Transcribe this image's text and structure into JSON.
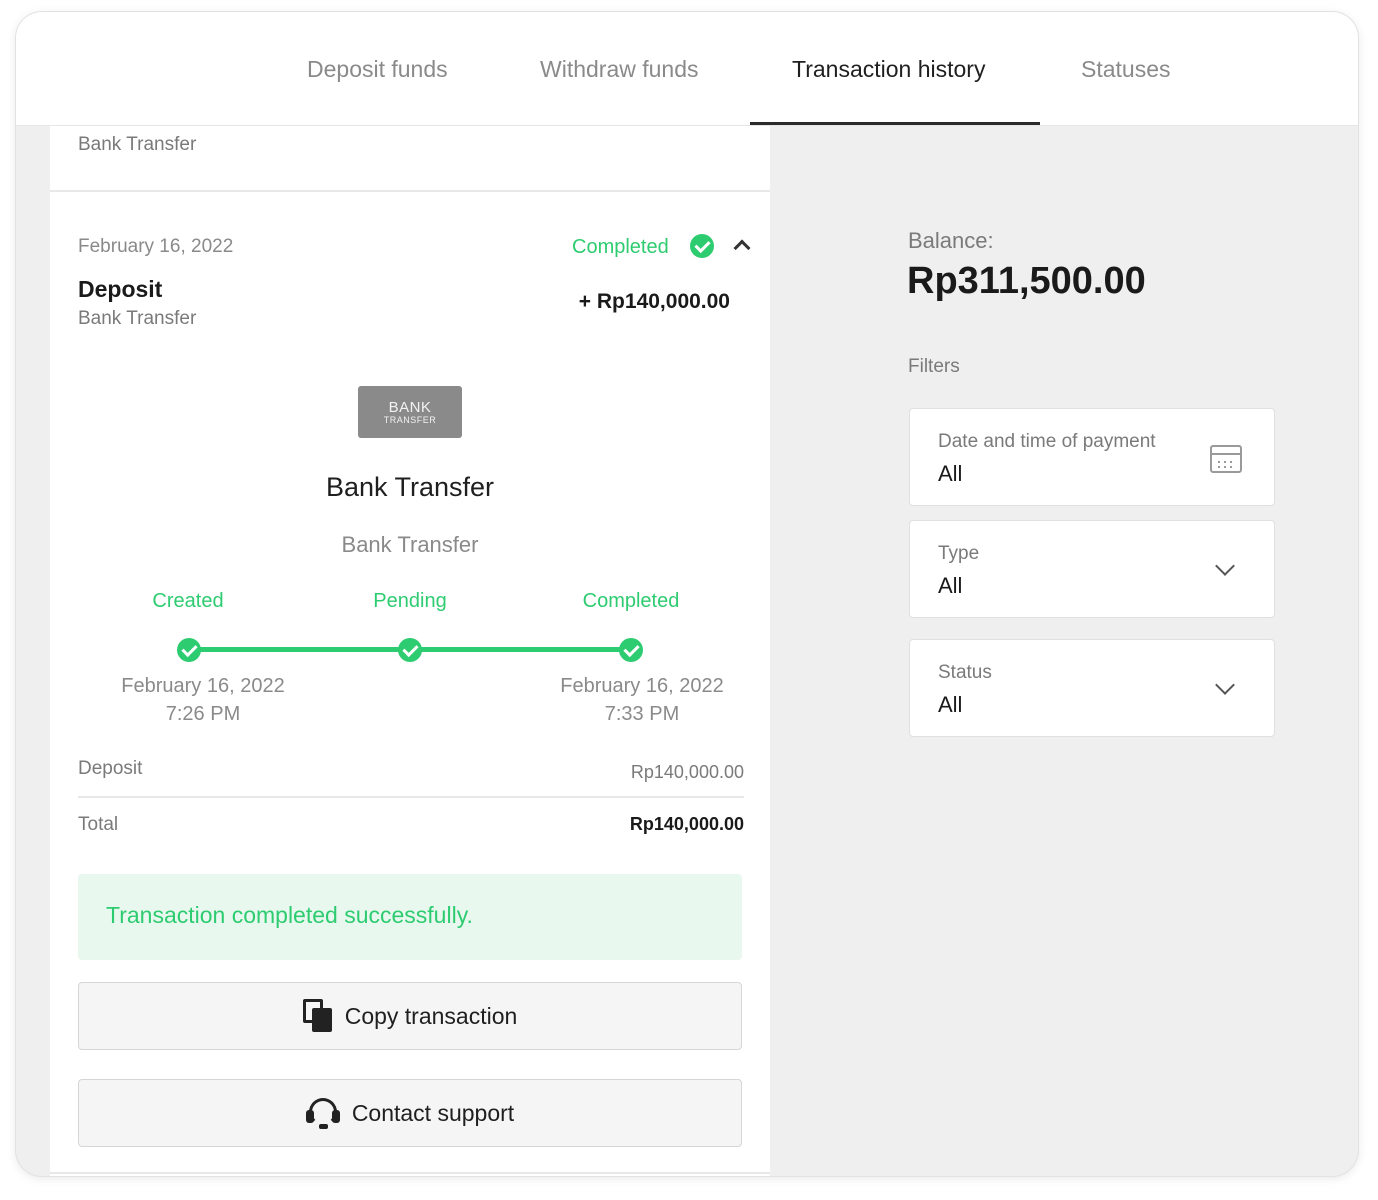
{
  "tabs": [
    {
      "label": "Deposit funds"
    },
    {
      "label": "Withdraw funds"
    },
    {
      "label": "Transaction history"
    },
    {
      "label": "Statuses"
    }
  ],
  "active_tab": "Transaction history",
  "previous_item": {
    "method": "Bank Transfer"
  },
  "transaction": {
    "date": "February 16, 2022",
    "status": "Completed",
    "type": "Deposit",
    "method": "Bank Transfer",
    "amount": "+ Rp140,000.00",
    "logo": {
      "line1": "BANK",
      "line2": "TRANSFER"
    },
    "method_name": "Bank Transfer",
    "method_sub": "Bank Transfer",
    "steps": [
      {
        "label": "Created",
        "date": "February 16, 2022",
        "time": "7:26 PM"
      },
      {
        "label": "Pending",
        "date": "",
        "time": ""
      },
      {
        "label": "Completed",
        "date": "February 16, 2022",
        "time": "7:33 PM"
      }
    ],
    "deposit_label": "Deposit",
    "deposit_value": "Rp140,000.00",
    "total_label": "Total",
    "total_value": "Rp140,000.00",
    "success_message": "Transaction completed successfully.",
    "copy_button": "Copy transaction",
    "support_button": "Contact support"
  },
  "sidebar": {
    "balance_label": "Balance:",
    "balance_value": "Rp311,500.00",
    "filters_label": "Filters",
    "filters": [
      {
        "label": "Date and time of payment",
        "value": "All",
        "icon": "calendar-icon"
      },
      {
        "label": "Type",
        "value": "All",
        "icon": "chevron-down-icon"
      },
      {
        "label": "Status",
        "value": "All",
        "icon": "chevron-down-icon"
      }
    ]
  },
  "colors": {
    "accent_green": "#2ecc71",
    "success_bg": "#e9f8ef"
  }
}
